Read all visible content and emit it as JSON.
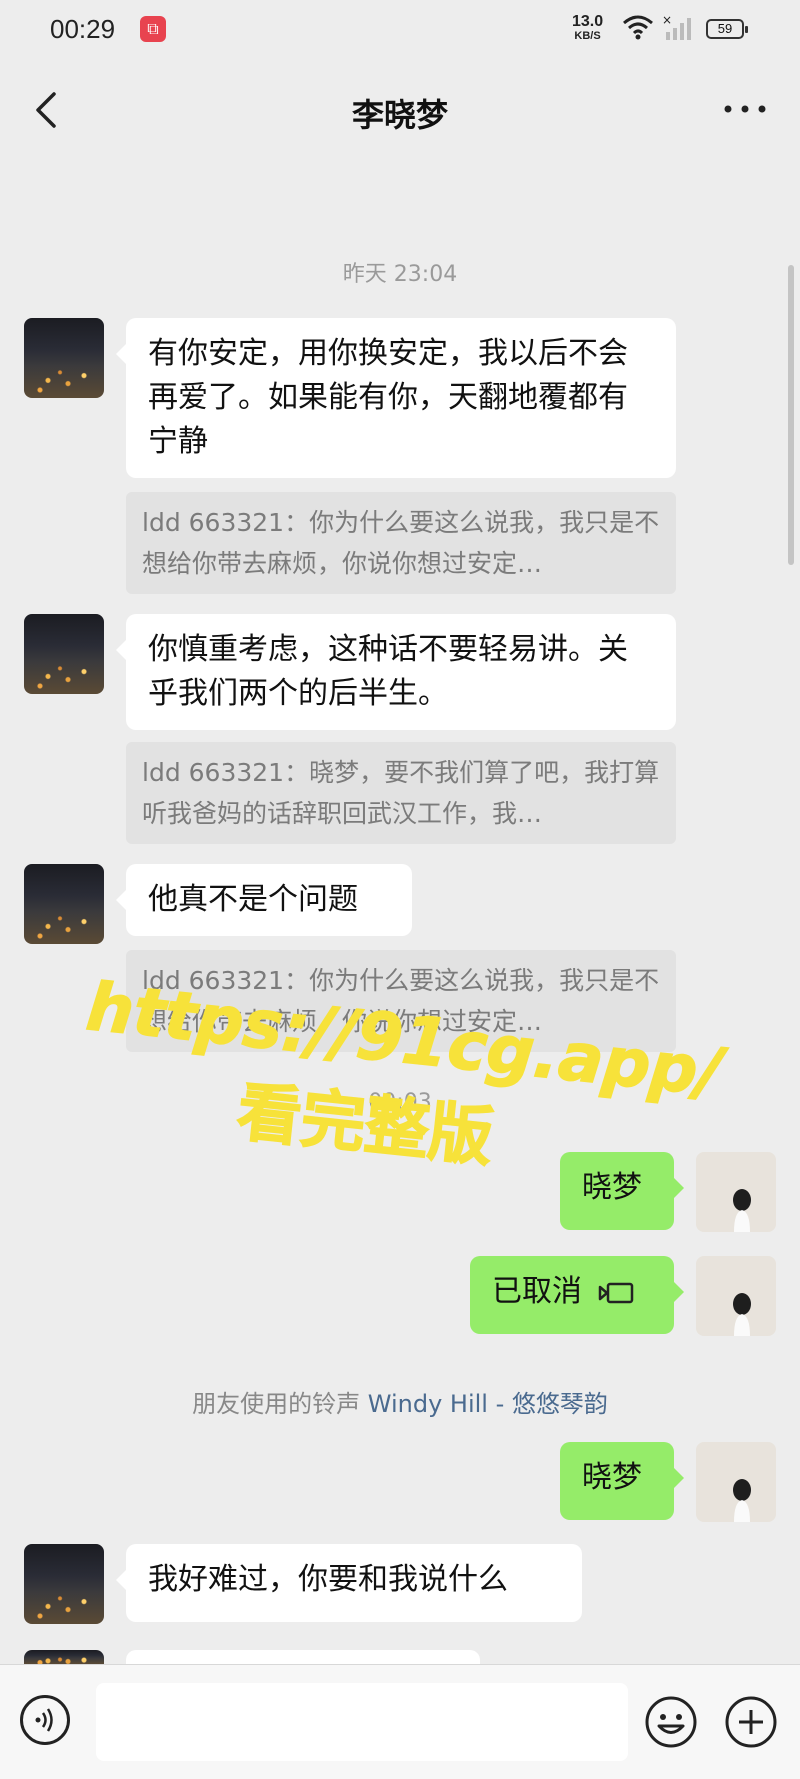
{
  "status_bar": {
    "time": "00:29",
    "net_speed_value": "13.0",
    "net_speed_unit": "KB/S",
    "battery": "59",
    "icons": [
      "crop-icon",
      "wifi-icon",
      "signal-icon",
      "battery-icon"
    ]
  },
  "header": {
    "title": "李晓梦",
    "icons": [
      "back-icon",
      "more-icon"
    ]
  },
  "messages": {
    "timestamp_1": "昨天 23:04",
    "m1": "有你安定，用你换安定，我以后不会再爱了。如果能有你，天翻地覆都有宁静",
    "q1": "ldd 663321：你为什么要这么说我，我只是不想给你带去麻烦，你说你想过安定…",
    "m2": "你慎重考虑，这种话不要轻易讲。关乎我们两个的后半生。",
    "q2": "ldd 663321：晓梦，要不我们算了吧，我打算听我爸妈的话辞职回武汉工作，我…",
    "m3": "他真不是个问题",
    "q3": "ldd 663321：你为什么要这么说我，我只是不想给你带去麻烦，你说你想过安定…",
    "timestamp_2": "00:03",
    "m4": "晓梦",
    "m5": "已取消",
    "system_prefix": "朋友使用的铃声 ",
    "system_song": "Windy Hill - 悠悠琴韵",
    "m6": "晓梦",
    "m7": "我好难过，你要和我说什么"
  },
  "watermark": {
    "line1": "https://91cg.app/",
    "line2": "看完整版",
    "color": "#f7e23a"
  },
  "input_bar": {
    "icons": [
      "voice-icon",
      "emoji-icon",
      "plus-icon"
    ]
  },
  "colors": {
    "background": "#ededed",
    "sent_bubble": "#95ec69",
    "received_bubble": "#ffffff"
  }
}
